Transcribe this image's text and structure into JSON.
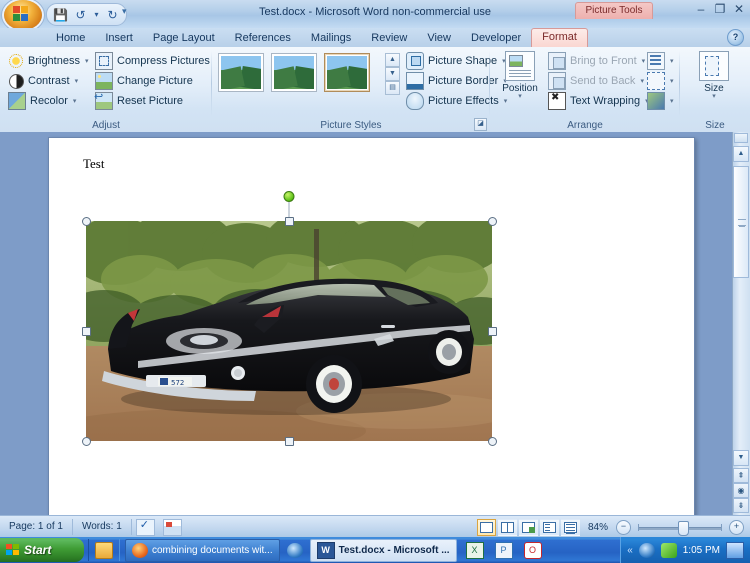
{
  "window": {
    "title": "Test.docx - Microsoft Word non-commercial use",
    "contextual_tab_group": "Picture Tools",
    "minimize": "–",
    "restore": "❐",
    "close": "✕",
    "help": "?"
  },
  "quick_access": {
    "office_button": "office-orb",
    "save": "💾",
    "undo": "↺",
    "undo_arrow": "▾",
    "redo": "↻",
    "customize": "▾"
  },
  "tabs": [
    {
      "label": "Home",
      "active": false
    },
    {
      "label": "Insert",
      "active": false
    },
    {
      "label": "Page Layout",
      "active": false
    },
    {
      "label": "References",
      "active": false
    },
    {
      "label": "Mailings",
      "active": false
    },
    {
      "label": "Review",
      "active": false
    },
    {
      "label": "View",
      "active": false
    },
    {
      "label": "Developer",
      "active": false
    },
    {
      "label": "Format",
      "active": true
    }
  ],
  "ribbon": {
    "groups": [
      {
        "name": "Adjust",
        "title": "Adjust",
        "items": [
          {
            "label": "Brightness",
            "icon": "brightness-icon",
            "dropdown": "▾"
          },
          {
            "label": "Contrast",
            "icon": "contrast-icon",
            "dropdown": "▾"
          },
          {
            "label": "Recolor",
            "icon": "recolor-icon",
            "dropdown": "▾"
          },
          {
            "label": "Compress Pictures",
            "icon": "compress-pictures-icon",
            "dropdown": ""
          },
          {
            "label": "Change Picture",
            "icon": "change-picture-icon",
            "dropdown": ""
          },
          {
            "label": "Reset Picture",
            "icon": "reset-picture-icon",
            "dropdown": ""
          }
        ]
      },
      {
        "name": "Picture Styles",
        "title": "Picture Styles",
        "gallery_up": "▲",
        "gallery_down": "▼",
        "gallery_more": "▤",
        "dialog_launcher": "◪",
        "items": [
          {
            "label": "Picture Shape",
            "icon": "picture-shape-icon",
            "dropdown": "▾"
          },
          {
            "label": "Picture Border",
            "icon": "picture-border-icon",
            "dropdown": "▾"
          },
          {
            "label": "Picture Effects",
            "icon": "picture-effects-icon",
            "dropdown": "▾"
          }
        ]
      },
      {
        "name": "Arrange",
        "title": "Arrange",
        "position_label": "Position",
        "position_arrow": "▾",
        "items": [
          {
            "label": "Bring to Front",
            "icon": "bring-to-front-icon",
            "dropdown": "▾",
            "disabled": true
          },
          {
            "label": "Send to Back",
            "icon": "send-to-back-icon",
            "dropdown": "▾",
            "disabled": true
          },
          {
            "label": "Text Wrapping",
            "icon": "text-wrapping-icon",
            "dropdown": "▾",
            "disabled": false
          }
        ],
        "small_buttons": [
          {
            "icon": "align-icon",
            "dropdown": "▾"
          },
          {
            "icon": "group-icon",
            "dropdown": "▾"
          },
          {
            "icon": "rotate-icon",
            "dropdown": "▾"
          }
        ]
      },
      {
        "name": "Size",
        "title": "Size",
        "size_label": "Size",
        "size_arrow": "▾"
      }
    ]
  },
  "document": {
    "body_text": "Test",
    "image_alt": "black-classic-car-photo"
  },
  "scrollbar": {
    "split": "split-bar",
    "up": "▲",
    "down": "▼",
    "prev_object": "⇞",
    "select_object": "◉",
    "next_object": "⇟"
  },
  "status_bar": {
    "page": "Page: 1 of 1",
    "words": "Words: 1",
    "proofing_icon": "proofing-errors-icon",
    "language_icon": "macro-record-icon",
    "views": [
      {
        "name": "print-layout-view",
        "active": true
      },
      {
        "name": "full-screen-reading-view",
        "active": false
      },
      {
        "name": "web-layout-view",
        "active": false
      },
      {
        "name": "outline-view",
        "active": false
      },
      {
        "name": "draft-view",
        "active": false
      }
    ],
    "zoom_label": "84%",
    "zoom_out": "−",
    "zoom_in": "+"
  },
  "taskbar": {
    "start_label": "Start",
    "quick_launch": [
      {
        "name": "show-desktop-icon"
      }
    ],
    "tasks": [
      {
        "label": "combining documents wit...",
        "icon": "firefox-icon",
        "active": false
      },
      {
        "label": "Test.docx - Microsoft ...",
        "icon": "word-icon",
        "active": true
      },
      {
        "label": "",
        "icon": "excel-icon",
        "active": false
      },
      {
        "label": "",
        "icon": "powerpoint-icon",
        "active": false
      },
      {
        "label": "",
        "icon": "opera-icon",
        "active": false
      }
    ],
    "separator_icon": "ie-icon",
    "tray_expand": "«",
    "tray_icons": [
      {
        "name": "network-icon"
      },
      {
        "name": "antivirus-icon"
      }
    ],
    "clock": "1:05 PM",
    "show_desktop": "show-desktop-button"
  }
}
